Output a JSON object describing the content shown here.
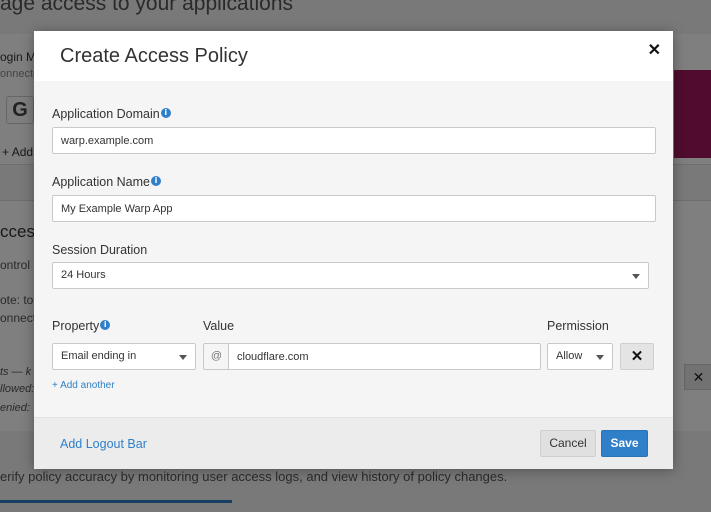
{
  "background": {
    "title": "age access to your applications",
    "login": "ogin M",
    "connected": "onnecte",
    "google_letter": "G",
    "add": "Add",
    "section_title": "cces",
    "control": "ontrol",
    "note": "ote: to",
    "connect": "onnect",
    "lists": "ts — k",
    "allowed": "llowed:",
    "denied": "enied:",
    "x": "✕",
    "verify": "erify policy accuracy by monitoring user access logs, and view history of policy changes."
  },
  "modal": {
    "title": "Create Access Policy",
    "close_icon": "✕",
    "application_domain": {
      "label": "Application Domain",
      "value": "warp.example.com"
    },
    "application_name": {
      "label": "Application Name",
      "value": "My Example Warp App"
    },
    "session_duration": {
      "label": "Session Duration",
      "value": "24 Hours"
    },
    "rule": {
      "property_label": "Property",
      "value_label": "Value",
      "permission_label": "Permission",
      "property_value": "Email ending in",
      "value_prefix": "@",
      "value": "cloudflare.com",
      "permission_value": "Allow",
      "remove_icon": "✕"
    },
    "add_another": "+ Add another",
    "footer": {
      "logout_link": "Add Logout Bar",
      "cancel": "Cancel",
      "save": "Save"
    }
  },
  "colors": {
    "accent": "#2f80c9",
    "brand_pink": "#a0185d"
  },
  "icons": {
    "info": "info-icon",
    "close": "close-icon",
    "dropdown": "chevron-down-icon"
  }
}
